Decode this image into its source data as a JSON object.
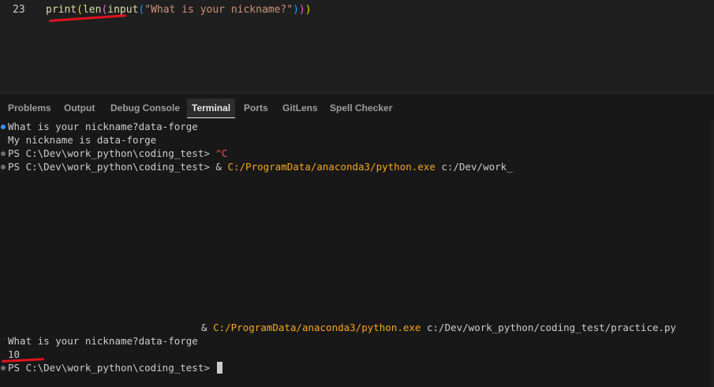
{
  "editor": {
    "line_number": "23",
    "code": {
      "print": "print",
      "open1": "(",
      "len": "len",
      "open2": "(",
      "input": "input",
      "open3": "(",
      "string": "\"What is your nickname?\"",
      "close3": ")",
      "close2": ")",
      "close1": ")"
    }
  },
  "panel": {
    "tabs": [
      {
        "label": "Problems"
      },
      {
        "label": "Output"
      },
      {
        "label": "Debug Console"
      },
      {
        "label": "Terminal"
      },
      {
        "label": "Ports"
      },
      {
        "label": "GitLens"
      },
      {
        "label": "Spell Checker"
      }
    ],
    "active_tab": "Terminal"
  },
  "terminal": {
    "line1": "What is your nickname?data-forge",
    "line2": "My nickname is data-forge",
    "line3_prompt": "PS C:\\Dev\\work_python\\coding_test> ",
    "line3_ctrl": "^C",
    "line4_prompt": "PS C:\\Dev\\work_python\\coding_test> ",
    "line4_amp": "& ",
    "line4_exe": "C:/ProgramData/anaconda3/python.exe",
    "line4_arg": " c:/Dev/work_",
    "line5_amp": "& ",
    "line5_exe": "C:/ProgramData/anaconda3/python.exe",
    "line5_arg": " c:/Dev/work_python/coding_test/practice.py",
    "line6": "What is your nickname?data-forge",
    "line7": "10",
    "line8_prompt": "PS C:\\Dev\\work_python\\coding_test> "
  },
  "colors": {
    "function": "#dcdcaa",
    "string": "#ce9178",
    "path": "#f5a623",
    "annotation": "#e0141e"
  }
}
